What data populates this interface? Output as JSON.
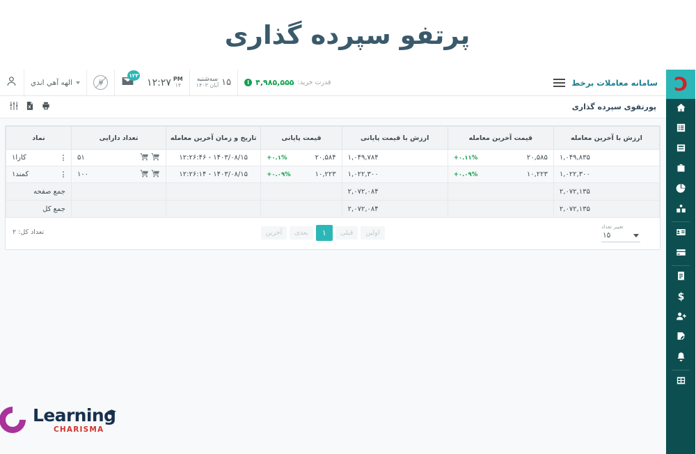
{
  "banner": {
    "title": "پرتفو سپرده گذاری"
  },
  "topbar": {
    "brand": "سامانه معاملات برخط",
    "menu_icon": "hamburger-icon",
    "power_label": "قدرت خرید:",
    "power_value": "۴,۹۸۵,۵۵۵",
    "date_day_num": "۱۵",
    "date_weekday": "سه‌شنبه",
    "date_month_year": "آبان ۱۴۰۳",
    "time": "۱۲:۲۷",
    "time_ampm": "PM",
    "time_sec": "۱۴",
    "mail_badge": "۱۲۳",
    "username": "الهه آهي اندي"
  },
  "panel": {
    "title": "پورتفوی سپرده گذاری",
    "icons": [
      "settings-sliders-icon",
      "excel-export-icon",
      "print-icon"
    ]
  },
  "table": {
    "columns": [
      "ارزش با آخرین معامله",
      "قیمت آخرین معامله",
      "ارزش با قیمت پایانی",
      "قیمت پایانی",
      "تاریخ و زمان آخرین معامله",
      "تعداد دارایی",
      "نماد"
    ],
    "rows": [
      {
        "value_last_trade": "۱,۰۴۹,۸۳۵",
        "last_trade_price": "۲۰,۵۸۵",
        "last_trade_pct": "+۰.۱۱%",
        "value_closing": "۱,۰۴۹,۷۸۴",
        "closing_price": "۲۰,۵۸۴",
        "closing_pct": "+۰.۱%",
        "datetime": "۱۴۰۳/۰۸/۱۵ - ۱۲:۲۶:۴۶",
        "quantity": "۵۱",
        "symbol": "کارا۱"
      },
      {
        "value_last_trade": "۱,۰۲۲,۳۰۰",
        "last_trade_price": "۱۰,۲۲۳",
        "last_trade_pct": "+۰.۰۹%",
        "value_closing": "۱,۰۲۲,۳۰۰",
        "closing_price": "۱۰,۲۲۳",
        "closing_pct": "+۰.۰۹%",
        "datetime": "۱۴۰۳/۰۸/۱۵ - ۱۲:۲۶:۱۴",
        "quantity": "۱۰۰",
        "symbol": "کمند۱"
      }
    ],
    "summaries": [
      {
        "label": "جمع صفحه",
        "value_last_trade": "۲,۰۷۲,۱۳۵",
        "value_closing": "۲,۰۷۲,۰۸۴"
      },
      {
        "label": "جمع کل",
        "value_last_trade": "۲,۰۷۲,۱۳۵",
        "value_closing": "۲,۰۷۲,۰۸۴"
      }
    ]
  },
  "footer": {
    "total_label": "تعداد کل: ۲",
    "pager": {
      "first": "اولین",
      "prev": "قبلی",
      "current": "۱",
      "next": "بعدی",
      "last": "آخرین"
    },
    "page_size_label": "تغییر تعداد",
    "page_size_value": "۱۵"
  },
  "sidebar": {
    "logo": "charisma-logo-icon",
    "items": [
      {
        "name": "home-icon"
      },
      {
        "name": "list-icon"
      },
      {
        "name": "card-icon"
      },
      {
        "name": "briefcase-icon"
      },
      {
        "name": "pie-chart-icon"
      },
      {
        "name": "portfolio-book-icon"
      },
      {
        "name": "id-card-icon"
      },
      {
        "name": "bank-card-icon"
      },
      {
        "name": "receipt-icon"
      },
      {
        "name": "dollar-icon"
      },
      {
        "name": "add-user-icon"
      },
      {
        "name": "edit-document-icon"
      },
      {
        "name": "bell-icon"
      },
      {
        "name": "grid-icon"
      }
    ]
  },
  "brandmark": {
    "line1": "Learning",
    "line2": "CHARISMA"
  },
  "colors": {
    "accent_teal": "#2bb7b7",
    "sidebar": "#0d4f50",
    "positive": "#13a150",
    "title": "#3a5a6b",
    "brand_red": "#d32026",
    "brand_purple": "#a8339a"
  }
}
